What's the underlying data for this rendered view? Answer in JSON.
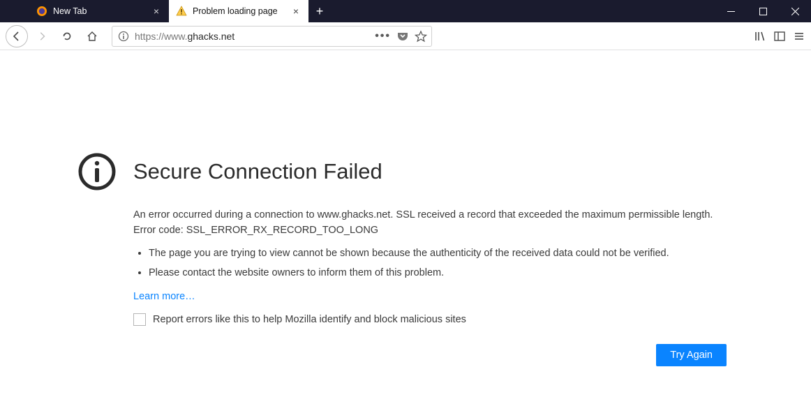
{
  "tabs": [
    {
      "label": "New Tab",
      "active": false
    },
    {
      "label": "Problem loading page",
      "active": true
    }
  ],
  "url": {
    "scheme": "https://www.",
    "host": "ghacks.net"
  },
  "error": {
    "title": "Secure Connection Failed",
    "description": "An error occurred during a connection to www.ghacks.net. SSL received a record that exceeded the maximum permissible length. Error code: SSL_ERROR_RX_RECORD_TOO_LONG",
    "bullets": [
      "The page you are trying to view cannot be shown because the authenticity of the received data could not be verified.",
      "Please contact the website owners to inform them of this problem."
    ],
    "learn_more": "Learn more…",
    "report_label": "Report errors like this to help Mozilla identify and block malicious sites",
    "try_again": "Try Again"
  }
}
